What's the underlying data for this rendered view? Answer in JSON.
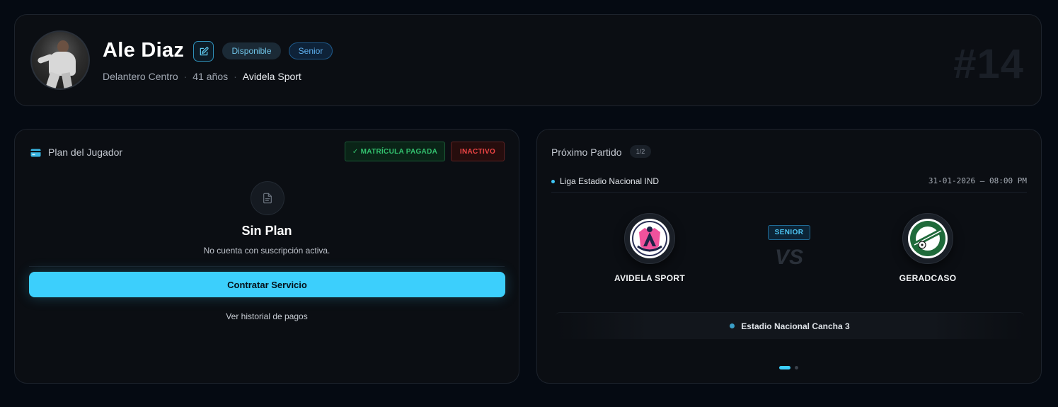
{
  "player": {
    "name": "Ale Diaz",
    "status": "Disponible",
    "category": "Senior",
    "position": "Delantero Centro",
    "age": "41 años",
    "club": "Avidela Sport",
    "jersey": "#14",
    "separator": "·"
  },
  "plan": {
    "title": "Plan del Jugador",
    "paid_badge": "✓ MATRÍCULA PAGADA",
    "status_badge": "INACTIVO",
    "empty_title": "Sin Plan",
    "empty_desc": "No cuenta con suscripción activa.",
    "cta_label": "Contratar Servicio",
    "history_link": "Ver historial de pagos"
  },
  "match": {
    "title": "Próximo Partido",
    "counter": "1/2",
    "league": "Liga Estadio Nacional IND",
    "datetime": "31-01-2026 — 08:00 PM",
    "category": "SENIOR",
    "vs": "VS",
    "home_team": "AVIDELA SPORT",
    "away_team": "GERADCASO",
    "venue": "Estadio Nacional Cancha 3",
    "page_index": 1,
    "page_total": 2
  },
  "colors": {
    "accent": "#3ccffc",
    "success": "#33c26f",
    "danger": "#ef4545",
    "background": "#050a12",
    "card": "#0b0e13"
  },
  "icons": {
    "edit": "pencil-square-icon",
    "plan": "credit-card-icon",
    "empty_plan": "document-icon",
    "league": "dot-icon",
    "venue": "location-dot-icon"
  }
}
